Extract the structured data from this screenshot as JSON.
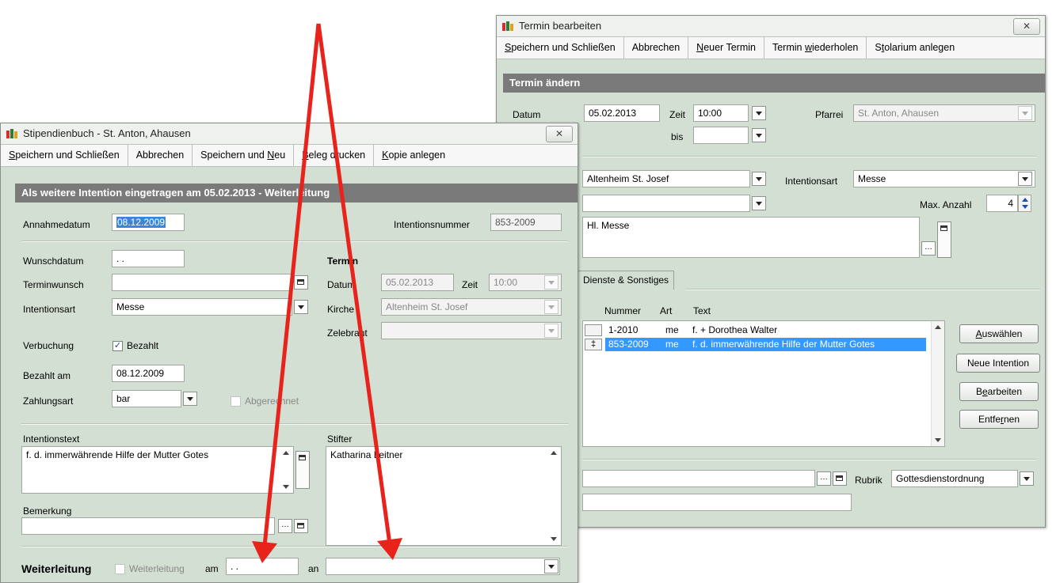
{
  "termin_window": {
    "title": "Termin bearbeiten",
    "close_label": "✕",
    "toolbar": [
      {
        "pre": "",
        "u": "S",
        "post": "peichern und Schließen"
      },
      {
        "pre": "Abbrechen",
        "u": "",
        "post": ""
      },
      {
        "pre": "",
        "u": "N",
        "post": "euer Termin"
      },
      {
        "pre": "Termin ",
        "u": "w",
        "post": "iederholen"
      },
      {
        "pre": "S",
        "u": "t",
        "post": "olarium anlegen"
      }
    ],
    "section_title": "Termin ändern",
    "datum_label": "Datum",
    "datum_value": "05.02.2013",
    "zeit_label": "Zeit",
    "zeit_value": "10:00",
    "bis_label": "bis",
    "bis_value": "",
    "pfarrei_label": "Pfarrei",
    "pfarrei_value": "St. Anton, Ahausen",
    "ort_value": "Altenheim St. Josef",
    "intentionsart_label": "Intentionsart",
    "intentionsart_value": "Messe",
    "combo2_value": "",
    "max_anzahl_label": "Max. Anzahl",
    "max_anzahl_value": "4",
    "text_value": "Hl. Messe",
    "tab_label": "Dienste & Sonstiges",
    "list_headers": {
      "nummer": "Nummer",
      "art": "Art",
      "text": "Text"
    },
    "list_rows": [
      {
        "mark": "",
        "nummer": "1-2010",
        "art": "me",
        "text": "f. + Dorothea Walter"
      },
      {
        "mark": "‡",
        "nummer": "853-2009",
        "art": "me",
        "text": "f. d. immerwährende Hilfe der Mutter Gotes"
      }
    ],
    "buttons": [
      {
        "pre": "",
        "u": "A",
        "post": "uswählen"
      },
      {
        "pre": "Neue Intention",
        "u": "",
        "post": ""
      },
      {
        "pre": "B",
        "u": "e",
        "post": "arbeiten"
      },
      {
        "pre": "Entfe",
        "u": "r",
        "post": "nen"
      }
    ],
    "bottom_field_value": "",
    "rubrik_label": "Rubrik",
    "rubrik_value": "Gottesdienstordnung",
    "bottom_field2_value": ""
  },
  "stipendienbuch_window": {
    "title": "Stipendienbuch - St. Anton, Ahausen",
    "close_label": "✕",
    "toolbar": [
      {
        "pre": "",
        "u": "S",
        "post": "peichern und Schließen"
      },
      {
        "pre": "Abbrechen",
        "u": "",
        "post": ""
      },
      {
        "pre": "Speichern und ",
        "u": "N",
        "post": "eu"
      },
      {
        "pre": "",
        "u": "B",
        "post": "eleg drucken"
      },
      {
        "pre": "",
        "u": "K",
        "post": "opie anlegen"
      }
    ],
    "section_title": "Als weitere Intention eingetragen am 05.02.2013 - Weiterleitung",
    "annahmedatum_label": "Annahmedatum",
    "annahmedatum_value": "08.12.2009",
    "intentionsnummer_label": "Intentionsnummer",
    "intentionsnummer_value": "853-2009",
    "wunschdatum_label": "Wunschdatum",
    "wunschdatum_value": ". .",
    "terminwunsch_label": "Terminwunsch",
    "terminwunsch_value": "",
    "intentionsart_label": "Intentionsart",
    "intentionsart_value": "Messe",
    "termin_heading": "Termin",
    "datum_label": "Datum",
    "datum_value": "05.02.2013",
    "zeit_label": "Zeit",
    "zeit_value": "10:00",
    "kirche_label": "Kirche",
    "kirche_value": "Altenheim St. Josef",
    "zelebrant_label": "Zelebrant",
    "zelebrant_value": "",
    "verbuchung_label": "Verbuchung",
    "bezahlt_check": "✓",
    "bezahlt_label": "Bezahlt",
    "bezahlt_am_label": "Bezahlt am",
    "bezahlt_am_value": "08.12.2009",
    "zahlungsart_label": "Zahlungsart",
    "zahlungsart_value": "bar",
    "abgerechnet_label": "Abgerechnet",
    "intentionstext_label": "Intentionstext",
    "intentionstext_value": "f. d. immerwährende Hilfe der Mutter Gotes",
    "stifter_label": "Stifter",
    "stifter_value": "Katharina Leitner",
    "bemerkung_label": "Bemerkung",
    "bemerkung_value": "",
    "weiterleitung_heading": "Weiterleitung",
    "weiterleitung_check_label": "Weiterleitung",
    "am_label": "am",
    "am_value": ". .",
    "an_label": "an",
    "an_value": ""
  },
  "colors": {
    "window_bg": "#d3dfd3",
    "header_bg": "#7a7a7a",
    "selection": "#3399ff",
    "arrow": "#e8231c"
  }
}
